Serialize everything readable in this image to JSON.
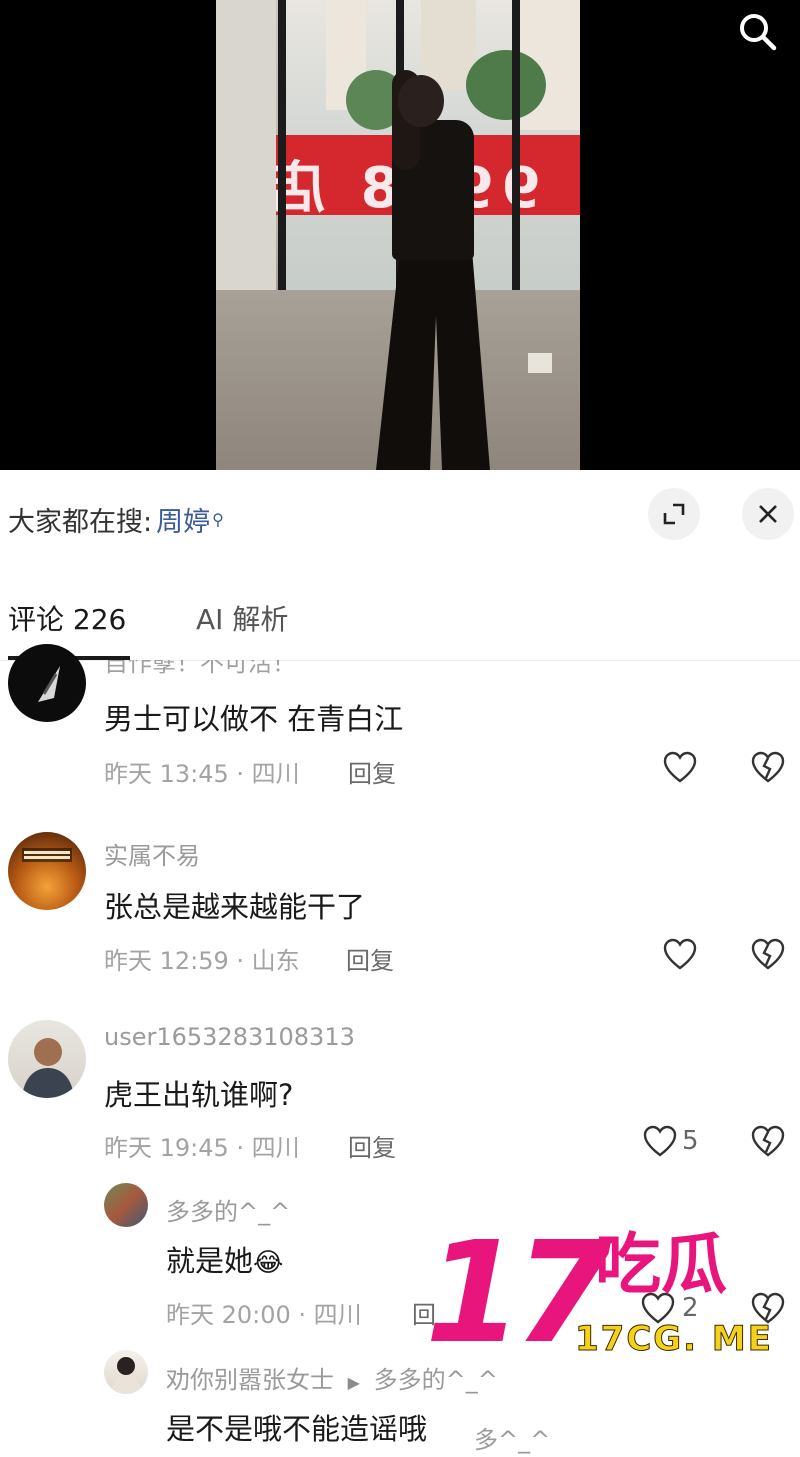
{
  "hot_search": {
    "label": "大家都在搜:",
    "term": "周婷"
  },
  "tabs": [
    {
      "label": "评论 226",
      "active": true
    },
    {
      "label": "AI 解析",
      "active": false
    }
  ],
  "clipped_username": "自作孽！不可活！",
  "comments": [
    {
      "username": "",
      "text": "男士可以做不    在青白江",
      "meta": "昨天 13:45 · 四川",
      "reply_label": "回复",
      "likes": ""
    },
    {
      "username": "实属不易",
      "text": "张总是越来越能干了",
      "meta": "昨天 12:59 · 山东",
      "reply_label": "回复",
      "likes": ""
    },
    {
      "username": "user1653283108313",
      "text": "虎王出轨谁啊?",
      "meta": "昨天 19:45 · 四川",
      "reply_label": "回复",
      "likes": "5"
    }
  ],
  "replies": [
    {
      "username": "多多的^_^",
      "text": "就是她",
      "emoji": "😂",
      "meta": "昨天 20:00 · 四川",
      "reply_label": "回",
      "likes": "2"
    },
    {
      "username": "劝你别嚣张女士",
      "reply_to_arrow": "▶",
      "reply_to": "多多的^_^",
      "text": "是不是哦不能造谣哦",
      "quote_tail": "多^_^"
    }
  ],
  "watermark": {
    "number": "17",
    "chinese": "吃瓜",
    "url": "17CG. ME"
  },
  "colors": {
    "link_blue": "#3b5b9a",
    "watermark_pink": "#e8157c",
    "watermark_yellow": "#f4d21a"
  },
  "icons": [
    "search-icon",
    "expand-icon",
    "close-icon",
    "heart-icon",
    "broken-heart-icon",
    "reply-arrow-icon"
  ]
}
